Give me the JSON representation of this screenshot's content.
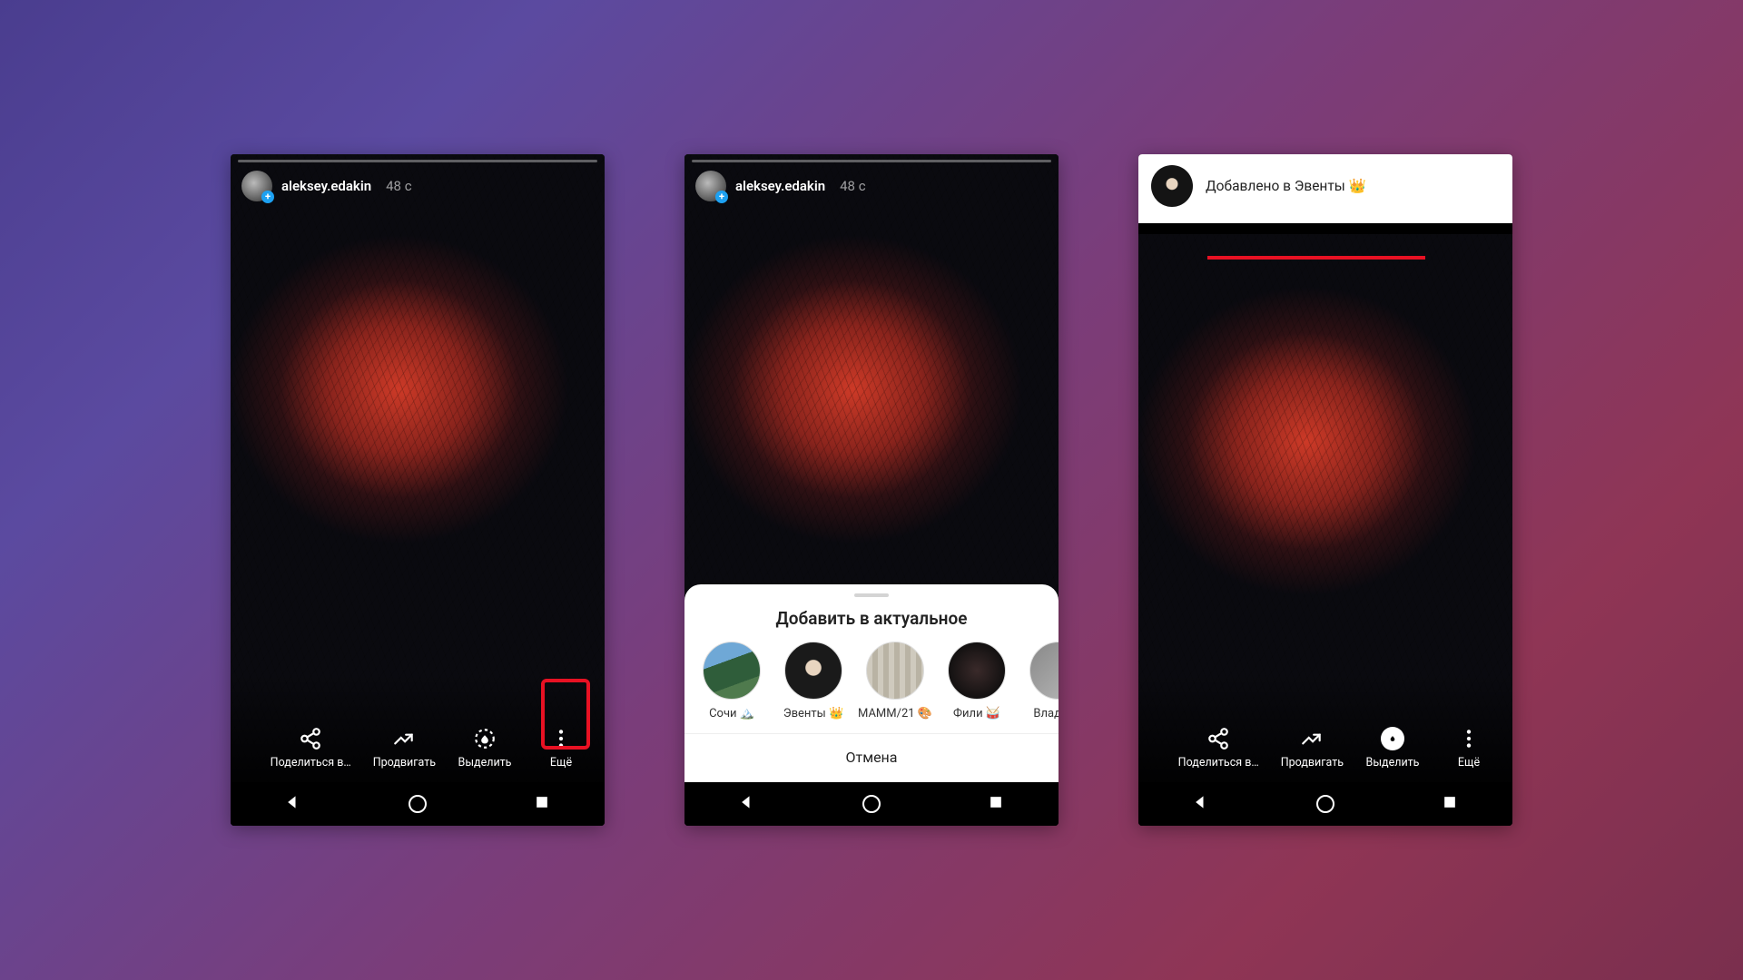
{
  "story": {
    "username": "aleksey.edakin",
    "time": "48 с"
  },
  "actions": {
    "share": "Поделиться в…",
    "promote": "Продвигать",
    "highlight": "Выделить",
    "more": "Ещё"
  },
  "sheet": {
    "title": "Добавить в актуальное",
    "cancel": "Отмена",
    "highlights": [
      {
        "label": "Сочи 🏔️"
      },
      {
        "label": "Эвенты 👑"
      },
      {
        "label": "МАММ/21 🎨"
      },
      {
        "label": "Фили 🥁"
      },
      {
        "label": "Владими"
      }
    ]
  },
  "toast": {
    "text": "Добавлено в Эвенты 👑"
  }
}
